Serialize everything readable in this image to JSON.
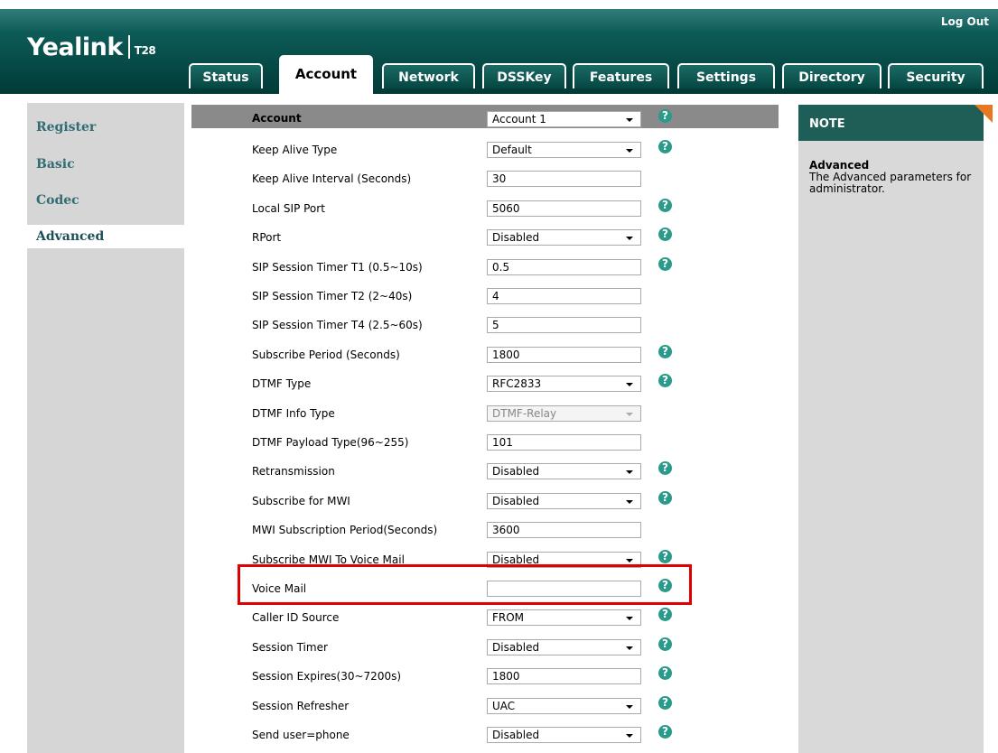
{
  "header": {
    "logo": "Yealink",
    "model": "T28",
    "logout": "Log Out",
    "tabs": [
      "Status",
      "Account",
      "Network",
      "DSSKey",
      "Features",
      "Settings",
      "Directory",
      "Security"
    ],
    "active_tab": "Account"
  },
  "sidebar": {
    "items": [
      "Register",
      "Basic",
      "Codec",
      "Advanced"
    ],
    "active": "Advanced"
  },
  "form": {
    "header_label": "Account",
    "header_value": "Account 1",
    "rows": [
      {
        "label": "Keep Alive Type",
        "value": "Default",
        "type": "select",
        "help": true
      },
      {
        "label": "Keep Alive Interval (Seconds)",
        "value": "30",
        "type": "text",
        "help": false
      },
      {
        "label": "Local SIP Port",
        "value": "5060",
        "type": "text",
        "help": true
      },
      {
        "label": "RPort",
        "value": "Disabled",
        "type": "select",
        "help": true
      },
      {
        "label": "SIP Session Timer T1 (0.5~10s)",
        "value": "0.5",
        "type": "text",
        "help": true
      },
      {
        "label": "SIP Session Timer T2 (2~40s)",
        "value": "4",
        "type": "text",
        "help": false
      },
      {
        "label": "SIP Session Timer T4 (2.5~60s)",
        "value": "5",
        "type": "text",
        "help": false
      },
      {
        "label": "Subscribe Period (Seconds)",
        "value": "1800",
        "type": "text",
        "help": true
      },
      {
        "label": "DTMF Type",
        "value": "RFC2833",
        "type": "select",
        "help": true
      },
      {
        "label": "DTMF Info Type",
        "value": "DTMF-Relay",
        "type": "select-disabled",
        "help": false
      },
      {
        "label": "DTMF Payload Type(96~255)",
        "value": "101",
        "type": "text",
        "help": false
      },
      {
        "label": "Retransmission",
        "value": "Disabled",
        "type": "select",
        "help": true
      },
      {
        "label": "Subscribe for MWI",
        "value": "Disabled",
        "type": "select",
        "help": true
      },
      {
        "label": "MWI Subscription Period(Seconds)",
        "value": "3600",
        "type": "text",
        "help": false
      },
      {
        "label": "Subscribe MWI To Voice Mail",
        "value": "Disabled",
        "type": "select",
        "help": true
      },
      {
        "label": "Voice Mail",
        "value": "",
        "type": "text",
        "help": true
      },
      {
        "label": "Caller ID Source",
        "value": "FROM",
        "type": "select",
        "help": true
      },
      {
        "label": "Session Timer",
        "value": "Disabled",
        "type": "select",
        "help": true
      },
      {
        "label": "Session Expires(30~7200s)",
        "value": "1800",
        "type": "text",
        "help": true
      },
      {
        "label": "Session Refresher",
        "value": "UAC",
        "type": "select",
        "help": true
      },
      {
        "label": "Send user=phone",
        "value": "Disabled",
        "type": "select",
        "help": true
      }
    ]
  },
  "note": {
    "heading": "NOTE",
    "title": "Advanced",
    "text": "The Advanced parameters for administrator."
  },
  "help_glyph": "?",
  "colors": {
    "header_dark": "#003a37",
    "help_icon": "#2a9a8a",
    "highlight": "#e00000",
    "note_corner": "#e87722"
  }
}
